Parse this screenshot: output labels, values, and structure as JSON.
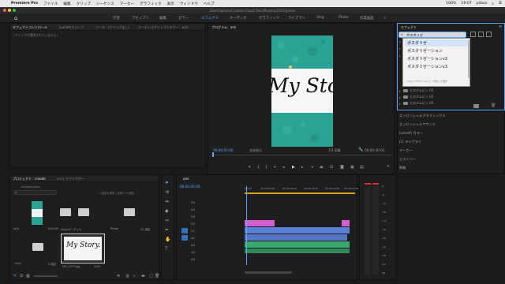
{
  "menubar": {
    "app_name": "Premiere Pro",
    "items": [
      "ファイル",
      "編集",
      "クリップ",
      "シーケンス",
      "マーカー",
      "グラフィック",
      "表示",
      "ウィンドウ",
      "ヘルプ"
    ],
    "clock": "19:07",
    "user": "pilaco",
    "battery": "100%"
  },
  "window_title": "/Users/pilaco/Creative Cloud Files/Monkey/2019 jpnms",
  "workspace_tabs": [
    "学習",
    "アセンブリ",
    "編集",
    "カラー",
    "エフェクト",
    "オーディオ",
    "グラフィック",
    "ライブラリ",
    "Vlog",
    "Photo",
    "作業画面"
  ],
  "workspace_active": "エフェクト",
  "left_panel": {
    "tabs": [
      "エフェクトコントロール",
      "Lumetriスコープ",
      "ソース：(クリップなし)",
      "オーディオクリップミキサー：ami"
    ],
    "empty_message": "(クリップが選択されていません)"
  },
  "program_monitor": {
    "tab": "プログラム：ami",
    "timecode": "00;00;05;00",
    "fit": "全体表示",
    "quality": "1/2 画質",
    "duration": "00;00;40;01",
    "frame_text": "My Story."
  },
  "effects_panel": {
    "title": "エフェクト",
    "search_value": "ポスタリゼ",
    "dropdown_items": [
      "ポスタリゼーション",
      "ポスタリゼーションv2",
      "ポスタリゼーションv3"
    ],
    "dropdown_hint": "ドロップダウンメニューを使って選択",
    "tree_items": [
      "ポスタリゼーション",
      "ポスタリゼーションv2",
      "ポスタリゼーションv3",
      "カスタムビン 01",
      "カスタムビン 02",
      "カスタムビン 03"
    ],
    "sections": [
      "エッセンシャルグラフィックス",
      "エッセンシャルサウンド",
      "Lumetri カラー",
      "CC ライブラリ",
      "マーカー",
      "ヒストリー",
      "情報"
    ]
  },
  "project_panel": {
    "tabs": [
      "プロジェクト：cmode",
      "メディアブラウザー"
    ],
    "file_name": "cmode.pproj",
    "selected_info": "1 項目を選択 / 全部で 9 項目",
    "items": [
      {
        "name": "ami",
        "meta": "5;00;00"
      },
      {
        "name": "Adobe",
        "meta": "Stock"
      },
      {
        "name": "Stockオーディオ",
        "meta": "3 項目"
      },
      {
        "name": "Photo",
        "meta": "12 項目"
      },
      {
        "name": "mixi",
        "meta": ""
      },
      {
        "name": "Title 01",
        "meta": "1 項目"
      },
      {
        "name": "MG_2177.jpg",
        "meta": "5;00"
      }
    ]
  },
  "timeline": {
    "tab": "ami",
    "timecode": "00;00;05;00",
    "ruler_marks": [
      "00;00",
      "00;00;05;00",
      "00;00;10;00",
      "00;00;15;00",
      "00;00;20;00",
      "00;00;25;00"
    ],
    "tracks": [
      "V5",
      "V4",
      "V3",
      "V2",
      "V1",
      "A1",
      "A2",
      "A3",
      "A4"
    ]
  },
  "audio_meter": {
    "labels": [
      "0",
      "-6",
      "-12",
      "-18",
      "-24",
      "-30",
      "-36",
      "-42",
      "-48",
      "-54",
      "dB"
    ]
  },
  "colors": {
    "accent": "#5aa6ff",
    "clip_pink": "#d45fd0",
    "clip_blue": "#5a7fd6",
    "clip_green": "#3aa86e",
    "teal_bg": "#2aa394"
  }
}
